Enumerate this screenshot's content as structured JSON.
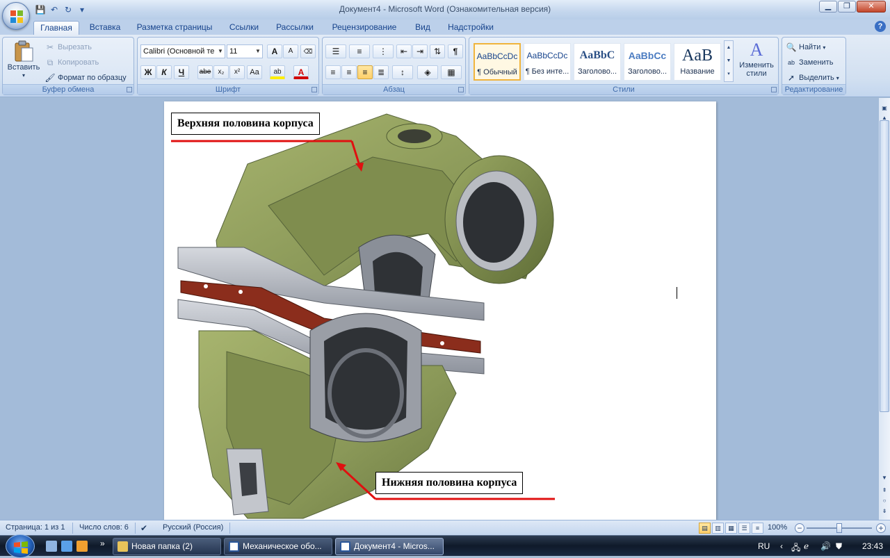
{
  "window": {
    "title": "Документ4 - Microsoft Word (Ознакомительная версия)",
    "minimize": "▁",
    "restore": "❐",
    "close": "✕"
  },
  "quick_access": [
    "save-icon",
    "undo-icon",
    "redo-icon",
    "customize-icon"
  ],
  "tabs": [
    "Главная",
    "Вставка",
    "Разметка страницы",
    "Ссылки",
    "Рассылки",
    "Рецензирование",
    "Вид",
    "Надстройки"
  ],
  "active_tab": "Главная",
  "help": "?",
  "clipboard": {
    "paste": "Вставить",
    "cut": "Вырезать",
    "copy": "Копировать",
    "format_painter": "Формат по образцу",
    "title": "Буфер обмена"
  },
  "font": {
    "name": "Calibri (Основной те",
    "size": "11",
    "grow": "A",
    "shrink": "A",
    "bold": "Ж",
    "italic": "К",
    "underline": "Ч",
    "strike": "abe",
    "subscript": "x₂",
    "superscript": "x²",
    "case": "Aa",
    "highlight": "ab",
    "color": "A",
    "title": "Шрифт"
  },
  "paragraph": {
    "title": "Абзац"
  },
  "styles": {
    "items": [
      {
        "sample": "AaBbCcDc",
        "name": "¶ Обычный",
        "selected": true
      },
      {
        "sample": "AaBbCcDc",
        "name": "¶ Без инте...",
        "selected": false
      },
      {
        "sample": "AaBbC",
        "name": "Заголово...",
        "selected": false
      },
      {
        "sample": "AaBbCc",
        "name": "Заголово...",
        "selected": false
      },
      {
        "sample": "AaB",
        "name": "Название",
        "selected": false
      }
    ],
    "change": "Изменить стили",
    "title": "Стили"
  },
  "editing": {
    "find": "Найти",
    "replace": "Заменить",
    "select": "Выделить",
    "title": "Редактирование"
  },
  "document": {
    "upper_label": "Верхняя половина корпуса",
    "lower_label": "Нижняя половина корпуса",
    "colors": {
      "body": "#8e9c5c",
      "flange": "#b8bcc4",
      "gasket": "#8b2d1c",
      "arrow": "#e01010"
    }
  },
  "status": {
    "page": "Страница: 1 из 1",
    "words": "Число слов: 6",
    "language": "Русский (Россия)",
    "zoom": "100%"
  },
  "taskbar": {
    "items": [
      {
        "label": "Новая папка (2)",
        "active": false
      },
      {
        "label": "Механическое обо...",
        "active": false
      },
      {
        "label": "Документ4 - Micros...",
        "active": true
      }
    ],
    "lang": "RU",
    "time": "23:43"
  }
}
